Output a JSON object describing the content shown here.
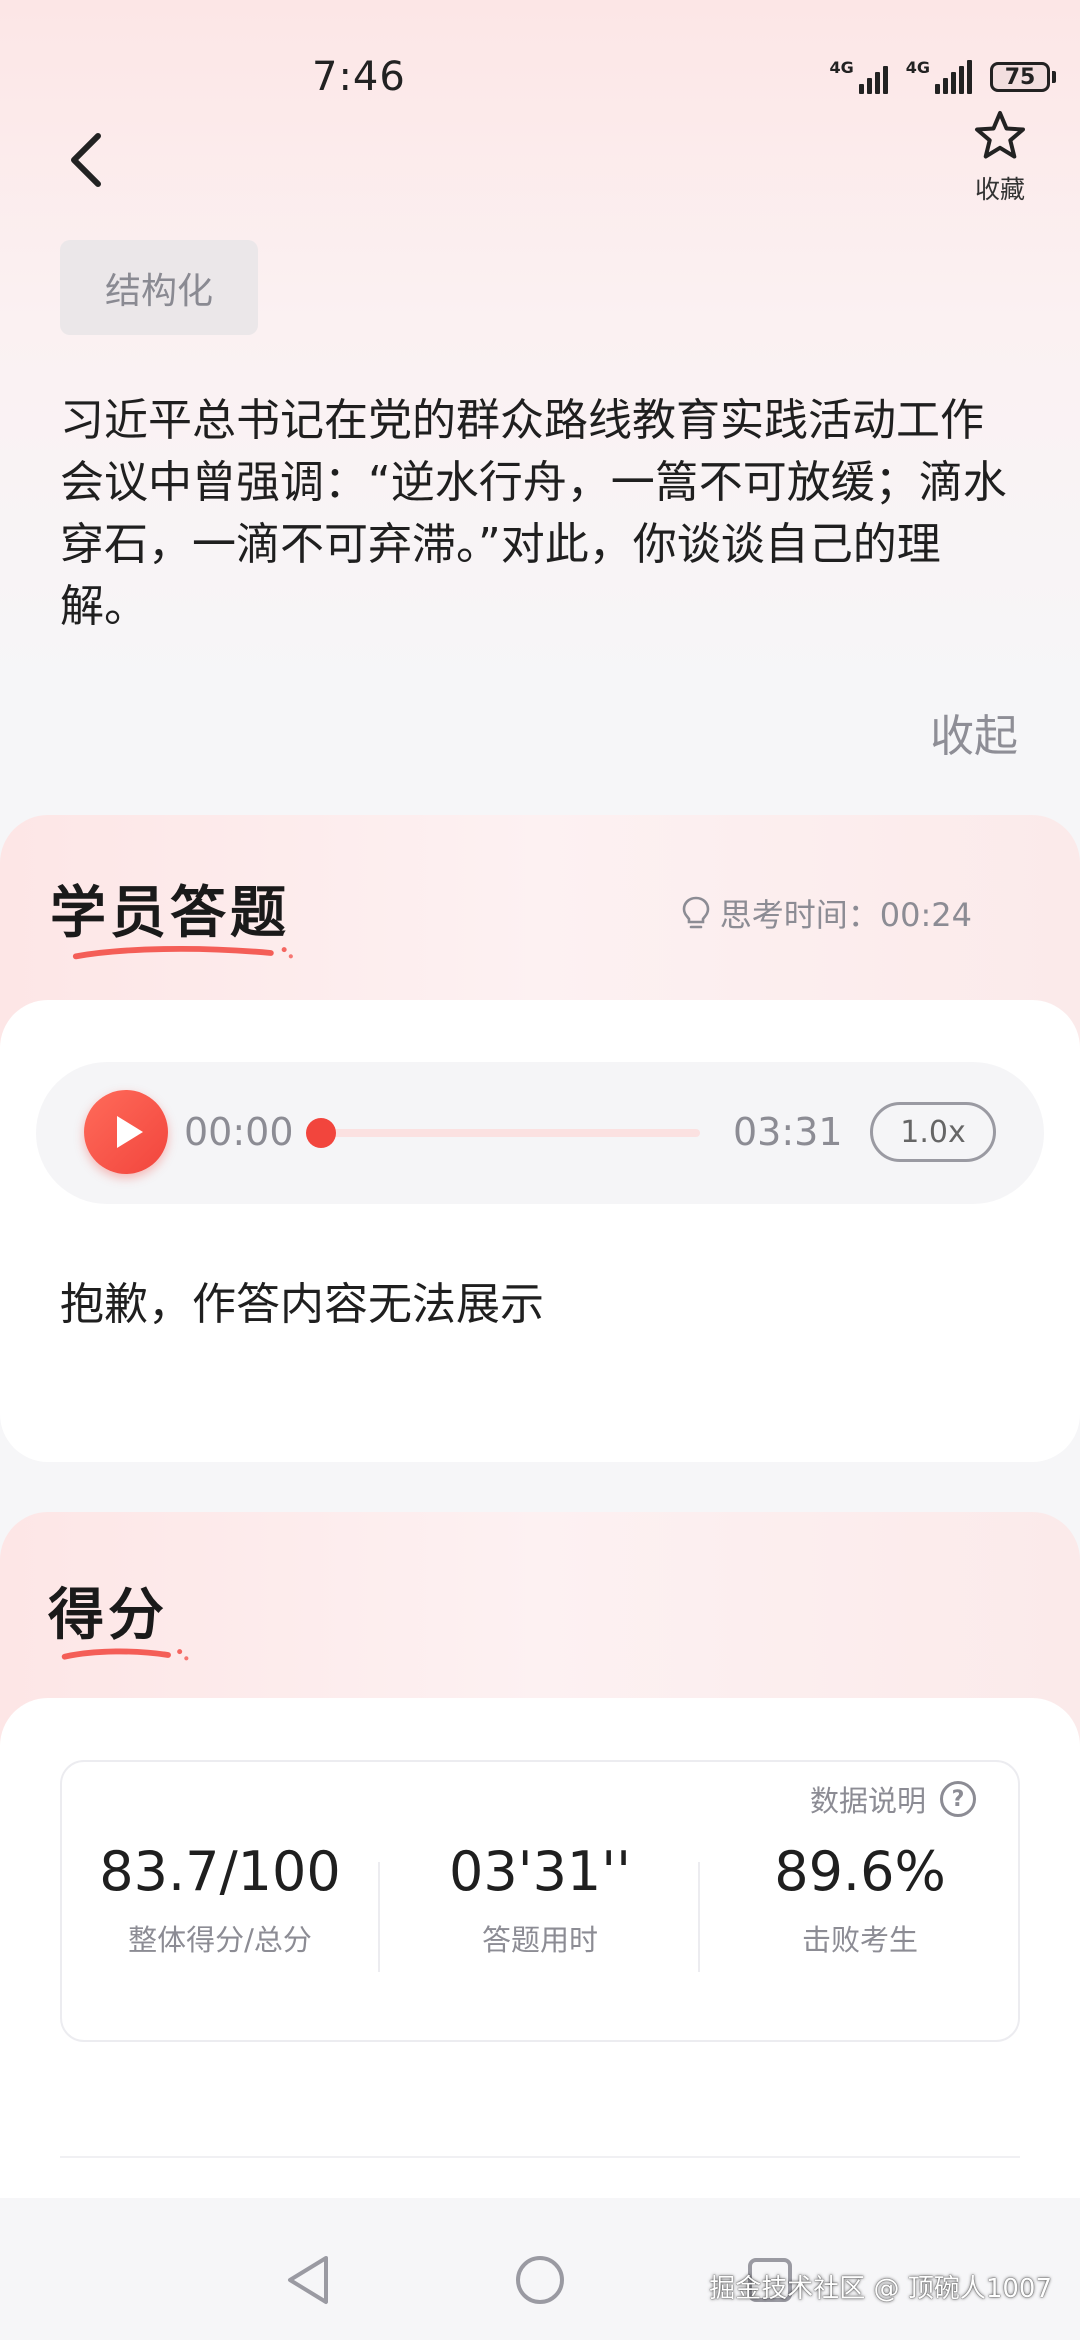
{
  "status_bar": {
    "time": "7:46",
    "network_1": "4G",
    "network_2": "4G",
    "battery": "75"
  },
  "header": {
    "back_icon": "chevron-left-icon",
    "favorite_icon": "star-outline-icon",
    "favorite_label": "收藏"
  },
  "question": {
    "tag": "结构化",
    "text": "习近平总书记在党的群众路线教育实践活动工作会议中曾强调：“逆水行舟，一篙不可放缓；滴水穿石，一滴不可弃滞。”对此，你谈谈自己的理解。",
    "collapse_label": "收起"
  },
  "answer_section": {
    "title": "学员答题",
    "think_icon": "lightbulb-icon",
    "think_label": "思考时间：00:24",
    "player": {
      "current_time": "00:00",
      "duration": "03:31",
      "speed": "1.0x",
      "progress": 0
    },
    "message": "抱歉，作答内容无法展示"
  },
  "score_section": {
    "title": "得分",
    "data_info_label": "数据说明",
    "help_icon": "question-circle-icon",
    "stats": [
      {
        "value": "83.7/100",
        "label": "整体得分/总分"
      },
      {
        "value": "03'31''",
        "label": "答题用时"
      },
      {
        "value": "89.6%",
        "label": "击败考生"
      }
    ]
  },
  "nav_bar": {
    "back_icon": "triangle-back-icon",
    "home_icon": "circle-home-icon",
    "recents_icon": "square-recents-icon"
  },
  "watermark": "掘金技术社区 @ 顶碗人1007",
  "colors": {
    "accent": "#f2453d",
    "muted_text": "#8c8c94",
    "header_gradient": "#fde6e6"
  }
}
